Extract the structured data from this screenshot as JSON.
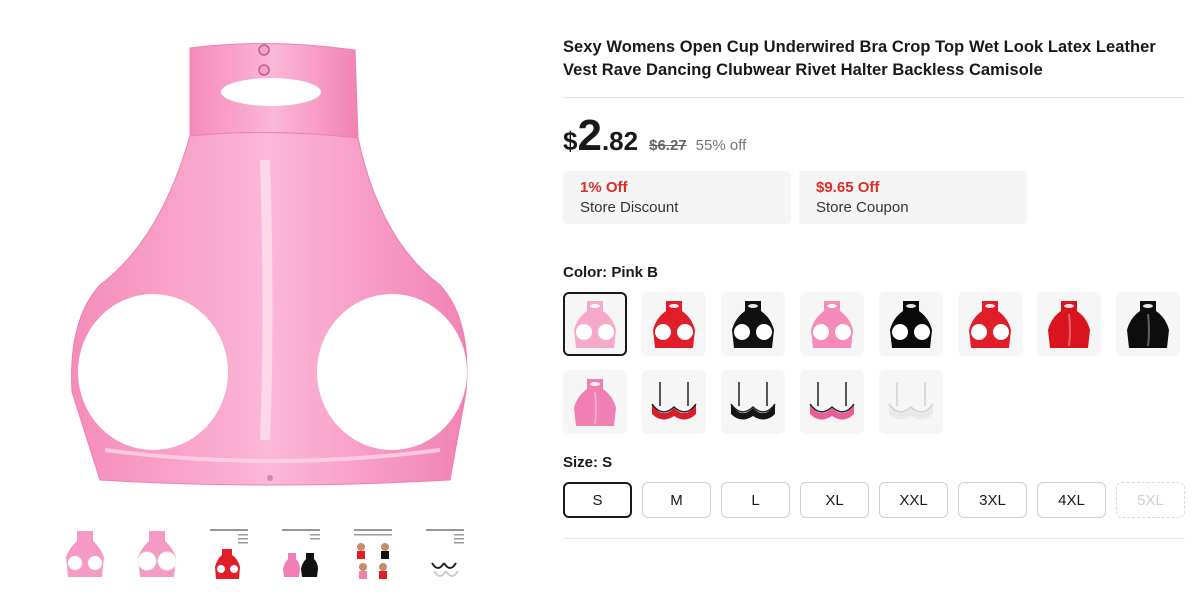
{
  "product": {
    "title": "Sexy Womens Open Cup Underwired Bra Crop Top Wet Look Latex Leather Vest Rave Dancing Clubwear Rivet Halter Backless Camisole"
  },
  "price": {
    "currency": "$",
    "integer": "2",
    "decimal": ".82",
    "original": "$6.27",
    "discount": "55% off"
  },
  "promos": [
    {
      "title": "1% Off",
      "subtitle": "Store Discount"
    },
    {
      "title": "$9.65 Off",
      "subtitle": "Store Coupon"
    }
  ],
  "color": {
    "label": "Color: Pink B",
    "options": [
      {
        "kind": "halter-top",
        "color": "#f7a9cc",
        "selected": true
      },
      {
        "kind": "halter-top",
        "color": "#e21d2a"
      },
      {
        "kind": "halter-top",
        "color": "#111111"
      },
      {
        "kind": "halter-top",
        "color": "#f38bbb"
      },
      {
        "kind": "halter-top",
        "color": "#0a0a0a"
      },
      {
        "kind": "halter-top",
        "color": "#e21d2a"
      },
      {
        "kind": "halter-vest",
        "color": "#d9141f"
      },
      {
        "kind": "halter-vest",
        "color": "#0d0d0d"
      },
      {
        "kind": "halter-vest",
        "color": "#f07fb4"
      },
      {
        "kind": "bra",
        "color": "#d61f2b"
      },
      {
        "kind": "bra",
        "color": "#151515"
      },
      {
        "kind": "bra",
        "color": "#ea5c96"
      },
      {
        "kind": "bra",
        "color": "#e9e9e9"
      }
    ]
  },
  "size": {
    "label": "Size: S",
    "options": [
      {
        "label": "S",
        "selected": true
      },
      {
        "label": "M"
      },
      {
        "label": "L"
      },
      {
        "label": "XL"
      },
      {
        "label": "XXL"
      },
      {
        "label": "3XL"
      },
      {
        "label": "4XL"
      },
      {
        "label": "5XL",
        "disabled": true
      }
    ]
  },
  "gallery": {
    "thumbnails": [
      {
        "kind": "photo",
        "color": "#f59ac4"
      },
      {
        "kind": "photo-open",
        "color": "#f59ac4"
      },
      {
        "kind": "chart",
        "color": "#e21d2a"
      },
      {
        "kind": "chart",
        "color": "#f07fb4"
      },
      {
        "kind": "chart-models",
        "color": "#e56a5d"
      },
      {
        "kind": "chart",
        "color": "#222222"
      }
    ]
  },
  "colors": {
    "accent": "#e02c26",
    "text": "#191919"
  }
}
